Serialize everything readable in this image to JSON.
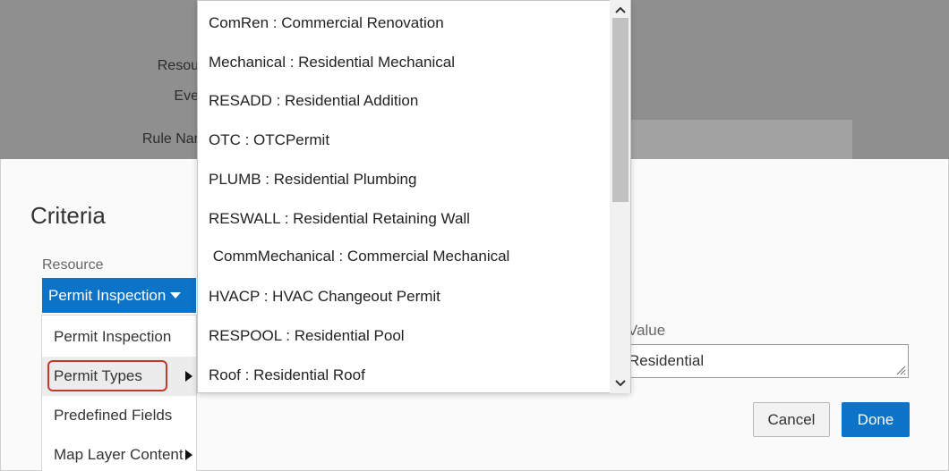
{
  "background": {
    "labels": {
      "resource": "Resou",
      "event": "Eve",
      "rule_name": "Rule Nar"
    }
  },
  "criteria": {
    "title": "Criteria",
    "resource_label": "Resource",
    "resource_selected": "Permit Inspection",
    "value_label": "Value",
    "value_text": "Residential",
    "cancel_label": "Cancel",
    "done_label": "Done"
  },
  "resource_menu": {
    "items": [
      {
        "label": "Permit Inspection",
        "has_submenu": false
      },
      {
        "label": "Permit Types",
        "has_submenu": true
      },
      {
        "label": "Predefined Fields",
        "has_submenu": false
      },
      {
        "label": "Map Layer Content",
        "has_submenu": true
      }
    ]
  },
  "permit_types": {
    "items": [
      "ComRen : Commercial Renovation",
      "Mechanical : Residential Mechanical",
      "RESADD : Residential Addition",
      "OTC : OTCPermit",
      "PLUMB : Residential Plumbing",
      "RESWALL : Residential Retaining Wall",
      " CommMechanical : Commercial Mechanical",
      "HVACP : HVAC Changeout Permit",
      "RESPOOL : Residential Pool",
      "Roof : Residential Roof"
    ]
  },
  "icons": {
    "scroll_up": "chevron-up-icon",
    "scroll_down": "chevron-down-icon",
    "submenu_arrow": "caret-right-icon",
    "dropdown_caret": "caret-down-icon",
    "resize_grip": "resize-grip-icon"
  },
  "colors": {
    "primary": "#0b73c8",
    "overlay": "#8f8f8f",
    "highlight_ring": "#c0392b"
  }
}
